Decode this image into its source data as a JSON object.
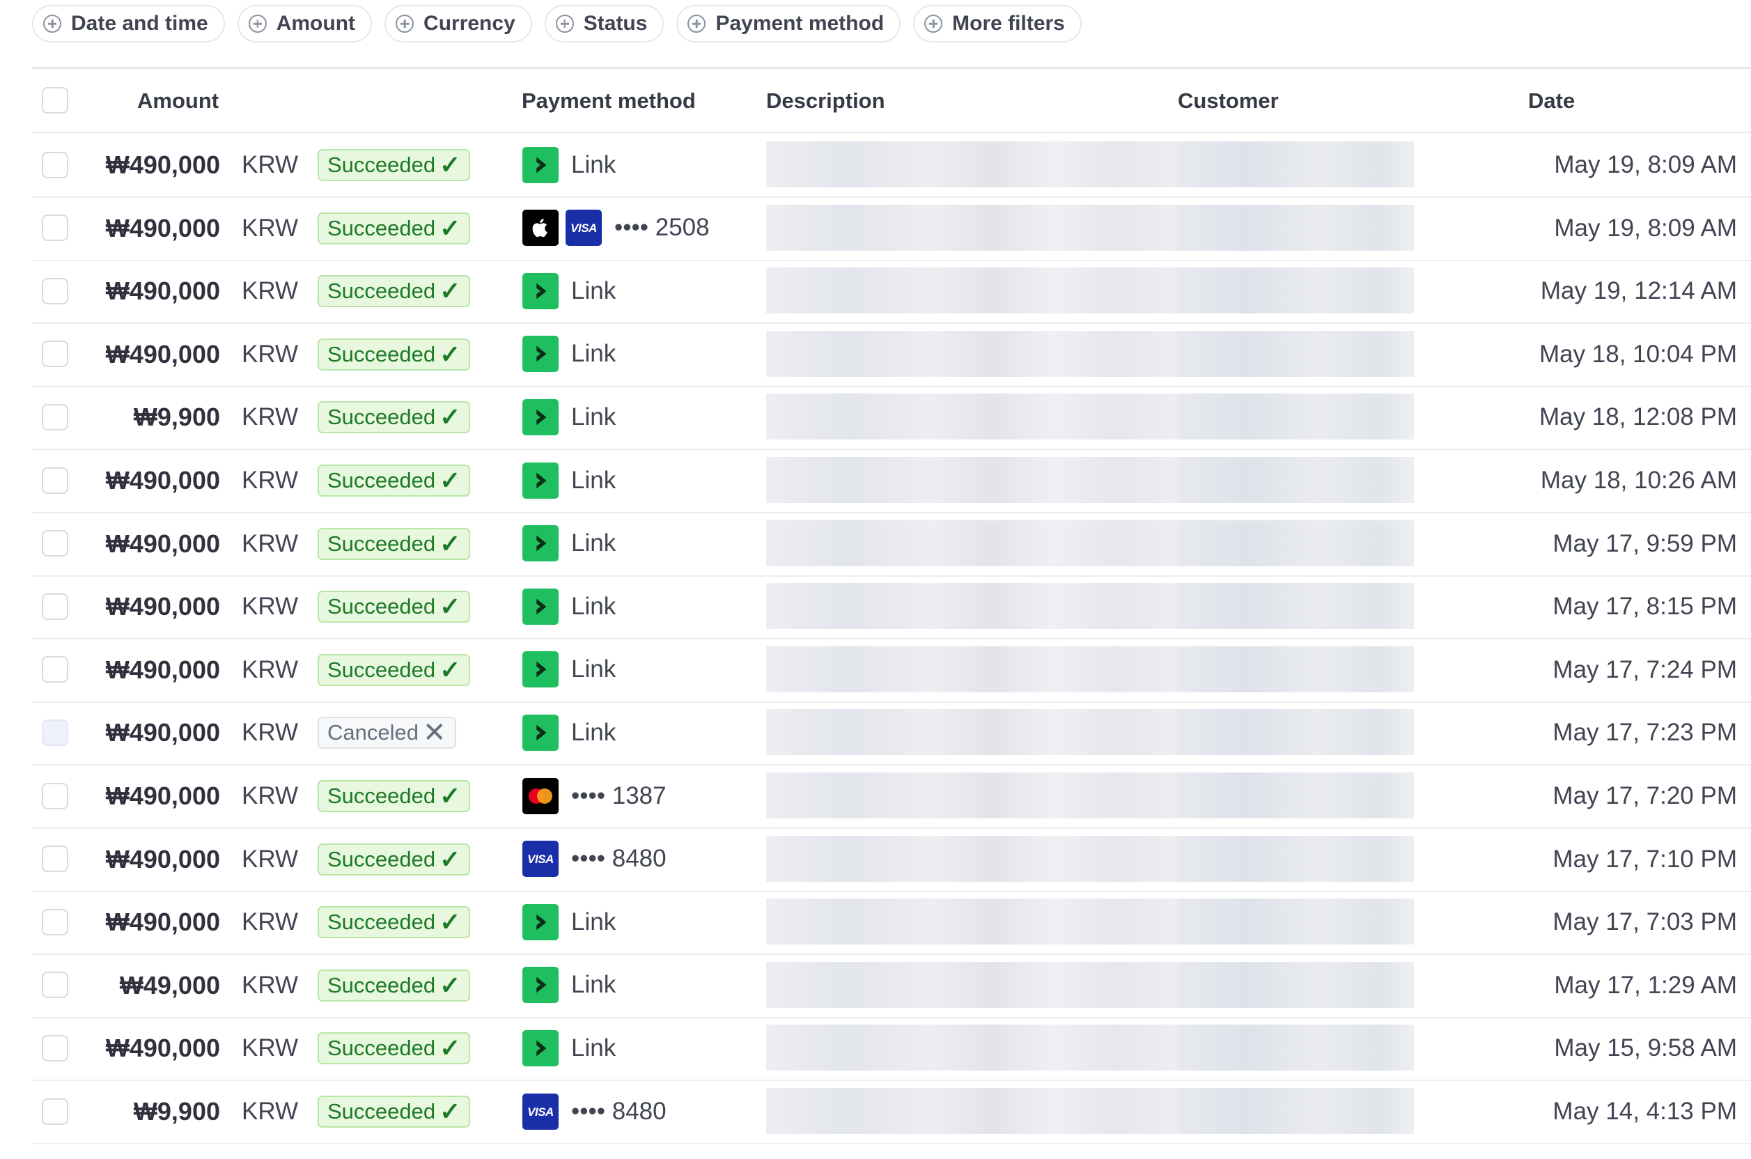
{
  "filters": [
    {
      "label": "Date and time",
      "icon": "plus-circle-icon"
    },
    {
      "label": "Amount",
      "icon": "plus-circle-icon"
    },
    {
      "label": "Currency",
      "icon": "plus-circle-icon"
    },
    {
      "label": "Status",
      "icon": "plus-circle-icon"
    },
    {
      "label": "Payment method",
      "icon": "plus-circle-icon"
    },
    {
      "label": "More filters",
      "icon": "plus-circle-icon"
    }
  ],
  "columns": {
    "amount": "Amount",
    "payment_method": "Payment method",
    "description": "Description",
    "customer": "Customer",
    "date": "Date"
  },
  "colors": {
    "succeeded_bg": "#e8f8df",
    "succeeded_text": "#1c7a27",
    "canceled_bg": "#f6f8fa",
    "link_green": "#1fbf5f",
    "visa_blue": "#1a2ea8"
  },
  "rows": [
    {
      "amount": "₩490,000",
      "currency": "KRW",
      "status": "Succeeded",
      "status_icon": "✓",
      "pm_icons": [
        "link-icon"
      ],
      "pm_text": "Link",
      "date": "May 19, 8:09 AM"
    },
    {
      "amount": "₩490,000",
      "currency": "KRW",
      "status": "Succeeded",
      "status_icon": "✓",
      "pm_icons": [
        "apple-pay-icon",
        "visa-icon"
      ],
      "pm_text": "•••• 2508",
      "date": "May 19, 8:09 AM"
    },
    {
      "amount": "₩490,000",
      "currency": "KRW",
      "status": "Succeeded",
      "status_icon": "✓",
      "pm_icons": [
        "link-icon"
      ],
      "pm_text": "Link",
      "date": "May 19, 12:14 AM"
    },
    {
      "amount": "₩490,000",
      "currency": "KRW",
      "status": "Succeeded",
      "status_icon": "✓",
      "pm_icons": [
        "link-icon"
      ],
      "pm_text": "Link",
      "date": "May 18, 10:04 PM"
    },
    {
      "amount": "₩9,900",
      "currency": "KRW",
      "status": "Succeeded",
      "status_icon": "✓",
      "pm_icons": [
        "link-icon"
      ],
      "pm_text": "Link",
      "date": "May 18, 12:08 PM"
    },
    {
      "amount": "₩490,000",
      "currency": "KRW",
      "status": "Succeeded",
      "status_icon": "✓",
      "pm_icons": [
        "link-icon"
      ],
      "pm_text": "Link",
      "date": "May 18, 10:26 AM"
    },
    {
      "amount": "₩490,000",
      "currency": "KRW",
      "status": "Succeeded",
      "status_icon": "✓",
      "pm_icons": [
        "link-icon"
      ],
      "pm_text": "Link",
      "date": "May 17, 9:59 PM"
    },
    {
      "amount": "₩490,000",
      "currency": "KRW",
      "status": "Succeeded",
      "status_icon": "✓",
      "pm_icons": [
        "link-icon"
      ],
      "pm_text": "Link",
      "date": "May 17, 8:15 PM"
    },
    {
      "amount": "₩490,000",
      "currency": "KRW",
      "status": "Succeeded",
      "status_icon": "✓",
      "pm_icons": [
        "link-icon"
      ],
      "pm_text": "Link",
      "date": "May 17, 7:24 PM"
    },
    {
      "amount": "₩490,000",
      "currency": "KRW",
      "status": "Canceled",
      "status_icon": "✕",
      "pm_icons": [
        "link-icon"
      ],
      "pm_text": "Link",
      "date": "May 17, 7:23 PM"
    },
    {
      "amount": "₩490,000",
      "currency": "KRW",
      "status": "Succeeded",
      "status_icon": "✓",
      "pm_icons": [
        "mastercard-icon"
      ],
      "pm_text": "•••• 1387",
      "date": "May 17, 7:20 PM"
    },
    {
      "amount": "₩490,000",
      "currency": "KRW",
      "status": "Succeeded",
      "status_icon": "✓",
      "pm_icons": [
        "visa-icon"
      ],
      "pm_text": "•••• 8480",
      "date": "May 17, 7:10 PM"
    },
    {
      "amount": "₩490,000",
      "currency": "KRW",
      "status": "Succeeded",
      "status_icon": "✓",
      "pm_icons": [
        "link-icon"
      ],
      "pm_text": "Link",
      "date": "May 17, 7:03 PM"
    },
    {
      "amount": "₩49,000",
      "currency": "KRW",
      "status": "Succeeded",
      "status_icon": "✓",
      "pm_icons": [
        "link-icon"
      ],
      "pm_text": "Link",
      "date": "May 17, 1:29 AM"
    },
    {
      "amount": "₩490,000",
      "currency": "KRW",
      "status": "Succeeded",
      "status_icon": "✓",
      "pm_icons": [
        "link-icon"
      ],
      "pm_text": "Link",
      "date": "May 15, 9:58 AM"
    },
    {
      "amount": "₩9,900",
      "currency": "KRW",
      "status": "Succeeded",
      "status_icon": "✓",
      "pm_icons": [
        "visa-icon"
      ],
      "pm_text": "•••• 8480",
      "date": "May 14, 4:13 PM"
    }
  ]
}
